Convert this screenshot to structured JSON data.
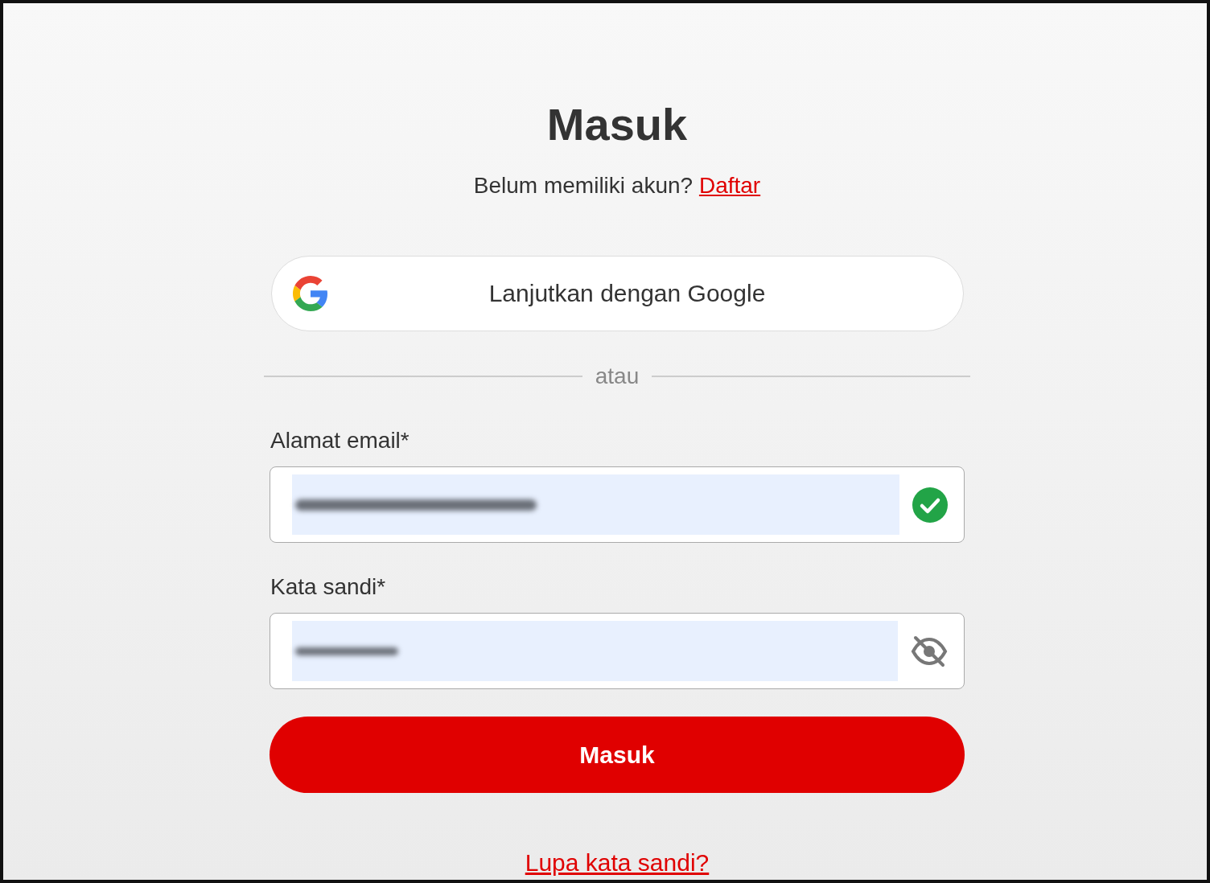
{
  "title": "Masuk",
  "signup_prompt": {
    "text": "Belum memiliki akun?",
    "link": "Daftar"
  },
  "google_button": {
    "label": "Lanjutkan dengan Google"
  },
  "divider": "atau",
  "fields": [
    {
      "kind": "email",
      "label": "Alamat email*",
      "valid": true,
      "autofilled": true
    },
    {
      "kind": "password",
      "label": "Kata sandi*",
      "visible": false,
      "autofilled": true
    }
  ],
  "submit": {
    "label": "Masuk"
  },
  "forgot_link": "Lupa kata sandi?"
}
